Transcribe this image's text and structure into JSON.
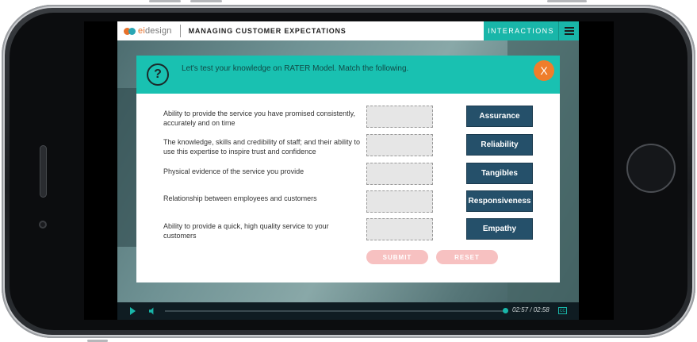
{
  "header": {
    "logo_text_a": "ei",
    "logo_text_b": "design",
    "course_title": "MANAGING CUSTOMER EXPECTATIONS",
    "interactions_label": "INTERACTIONS",
    "menu_icon": "hamburger-menu-icon"
  },
  "modal": {
    "question_icon": "?",
    "instruction": "Let's test your knowledge on RATER Model. Match the following.",
    "close_label": "X",
    "statements": [
      "Ability to provide the service you have promised consistently, accurately and on time",
      "The knowledge, skills and credibility of staff; and their ability to use this expertise to inspire trust and confidence",
      "Physical evidence of the service you provide",
      "Relationship between employees and customers",
      "Ability to provide a quick, high quality service to your customers"
    ],
    "answers": [
      "Assurance",
      "Reliability",
      "Tangibles",
      "Responsiveness",
      "Empathy"
    ],
    "submit_label": "SUBMIT",
    "reset_label": "RESET"
  },
  "player": {
    "time": "02:57 / 02:58",
    "cc_label": "CC",
    "progress_fraction": 0.99
  },
  "colors": {
    "teal": "#19c1b1",
    "navy_button": "#25506a",
    "orange_close": "#ef7d2b",
    "pink_disabled": "#f7c1c1"
  }
}
